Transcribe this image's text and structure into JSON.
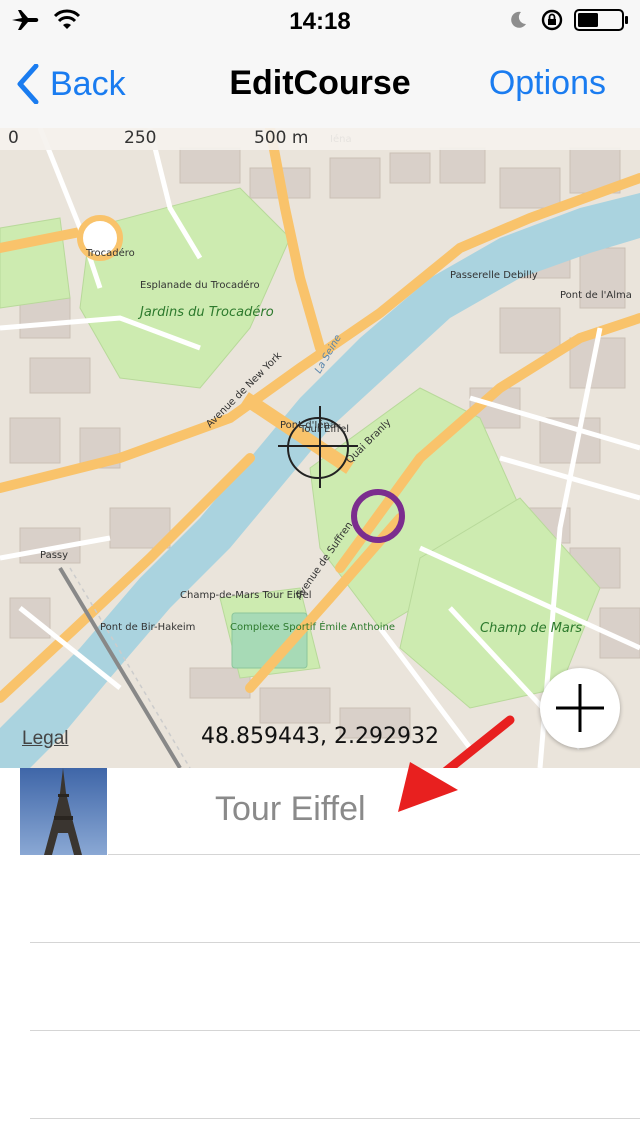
{
  "status_bar": {
    "time": "14:18",
    "icons": [
      "airplane-icon",
      "wifi-icon",
      "moon-icon",
      "rotation-lock-icon",
      "battery-icon"
    ]
  },
  "nav": {
    "back_label": "Back",
    "title": "EditCourse",
    "options_label": "Options"
  },
  "map": {
    "scale_labels": [
      "0",
      "250",
      "500 m"
    ],
    "legal_label": "Legal",
    "coordinates": "48.859443, 2.292932",
    "place_labels": [
      "Iéna",
      "Trocadéro",
      "Jardins du Trocadéro",
      "Esplanade du Trocadéro",
      "Passy",
      "Pont de Bir-Hakeim",
      "Champ-de-Mars Tour Eiffel",
      "Champ de Mars",
      "Pont d'Iéna",
      "Quai Branly",
      "Tour Eiffel",
      "Complexe Sportif Émile Anthoine",
      "Pont de l'Alma",
      "Passerelle Debilly",
      "La Seine",
      "Avenue de New York",
      "Avenue de Suffren"
    ],
    "colors": {
      "land": "#eae4db",
      "water": "#aad3df",
      "park": "#cdebb0",
      "major_road": "#f9c36b",
      "minor_road": "#ffffff",
      "building": "#d9d0c9",
      "target_marker": "#7b2d8e"
    }
  },
  "annotation_arrow_color": "#e8201f",
  "course_list": [
    {
      "label": "Tour Eiffel",
      "has_thumbnail": true
    },
    {
      "label": ""
    },
    {
      "label": ""
    },
    {
      "label": ""
    }
  ]
}
